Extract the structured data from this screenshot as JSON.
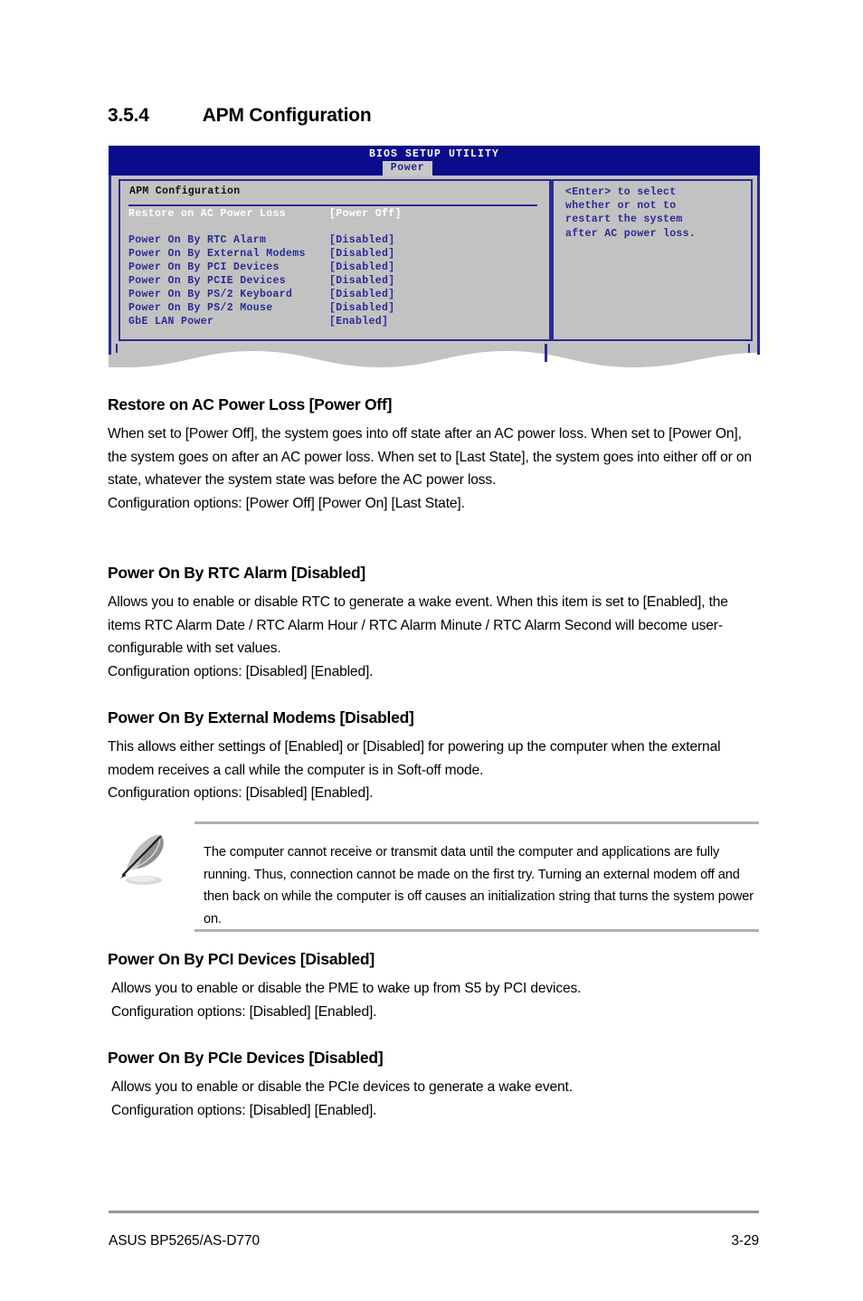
{
  "section": {
    "number": "3.5.4",
    "title": "APM Configuration"
  },
  "bios": {
    "utility_title": "BIOS SETUP UTILITY",
    "active_tab": "Power",
    "panel_heading": "APM Configuration",
    "items": [
      {
        "label": "Restore on AC Power Loss",
        "value": "[Power Off]",
        "selected": true
      },
      {
        "label": "Power On By RTC Alarm",
        "value": "[Disabled]",
        "selected": false
      },
      {
        "label": "Power On By External Modems",
        "value": "[Disabled]",
        "selected": false
      },
      {
        "label": "Power On By PCI Devices",
        "value": "[Disabled]",
        "selected": false
      },
      {
        "label": "Power On By PCIE Devices",
        "value": "[Disabled]",
        "selected": false
      },
      {
        "label": "Power On By PS/2 Keyboard",
        "value": "[Disabled]",
        "selected": false
      },
      {
        "label": "Power On By PS/2 Mouse",
        "value": "[Disabled]",
        "selected": false
      },
      {
        "label": "GbE LAN Power",
        "value": "[Enabled]",
        "selected": false
      }
    ],
    "help_text": "<Enter> to select\nwhether or not to\nrestart the system\nafter AC power loss.",
    "colors": {
      "titlebar": "#0b0b8c",
      "panel_bg": "#c2c2c2",
      "border": "#2a2a93",
      "text": "#2a2a93",
      "selected_text": "#ffffff",
      "tab_bg": "#c8c8c8"
    }
  },
  "sections": [
    {
      "heading": "Restore on AC Power Loss [Power Off]",
      "body": "When set to [Power Off], the system goes into off state after an AC power loss. When set to [Power On], the system goes on after an AC power loss. When set to [Last State], the system goes into either off or on state, whatever the system state was before the AC power loss.\nConfiguration options: [Power Off] [Power On] [Last State]."
    },
    {
      "heading": "Power On By RTC Alarm [Disabled]",
      "body": "Allows you to enable or disable RTC to generate a wake event. When this item is set to [Enabled], the items RTC Alarm Date / RTC Alarm Hour / RTC Alarm Minute / RTC Alarm Second will become user-configurable with set values.\nConfiguration options: [Disabled] [Enabled]."
    },
    {
      "heading": "Power On By External Modems [Disabled]",
      "body": "This allows either settings of [Enabled] or [Disabled] for powering up the computer when the external modem receives a call while the computer is in Soft-off mode.\nConfiguration options: [Disabled] [Enabled]."
    },
    {
      "heading": "Power On By PCI Devices [Disabled]",
      "body": "Allows you to enable or disable the PME to wake up from S5 by PCI devices.\nConfiguration options: [Disabled] [Enabled]."
    },
    {
      "heading": "Power On By PCIe Devices [Disabled]",
      "body": "Allows you to enable or disable the PCIe devices to generate a wake event.\nConfiguration options: [Disabled] [Enabled]."
    }
  ],
  "note": {
    "icon": "quill-pen-icon",
    "text": "The computer cannot receive or transmit data until the computer and applications are fully running. Thus, connection cannot be made on the first try. Turning an external modem off and then back on while the computer is off causes an initialization string that turns the system power on."
  },
  "footer": {
    "product": "ASUS BP5265/AS-D770",
    "page": "3-29"
  }
}
